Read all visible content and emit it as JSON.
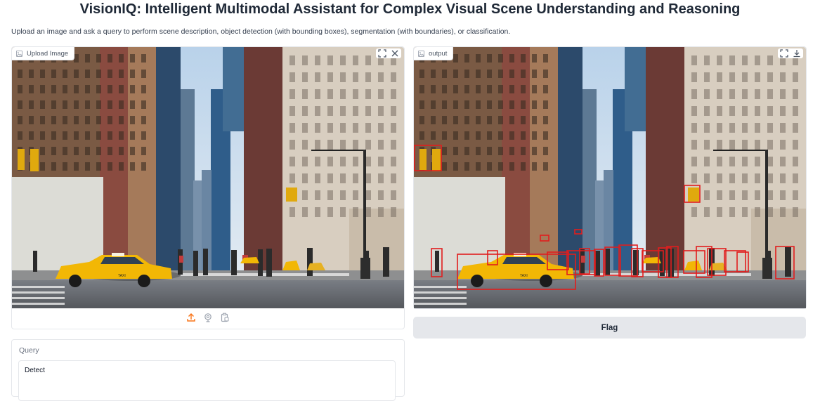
{
  "header": {
    "title": "VisionIQ: Intelligent Multimodal Assistant for Complex Visual Scene Understanding and Reasoning",
    "description": "Upload an image and ask a query to perform scene description, object detection (with bounding boxes), segmentation (with boundaries), or classification."
  },
  "upload": {
    "label": "Upload Image",
    "icons": [
      "image-icon",
      "fullscreen-icon",
      "close-icon",
      "upload-icon",
      "webcam-icon",
      "clipboard-icon"
    ]
  },
  "output": {
    "label": "output",
    "icons": [
      "image-icon",
      "fullscreen-icon",
      "download-icon"
    ]
  },
  "flag": {
    "label": "Flag"
  },
  "query": {
    "label": "Query",
    "value": "Detect"
  },
  "colors": {
    "accent": "#f97316",
    "detection_box": "#e11d1d",
    "taxi": "#f2b705"
  },
  "scene_sign": "TAXI"
}
